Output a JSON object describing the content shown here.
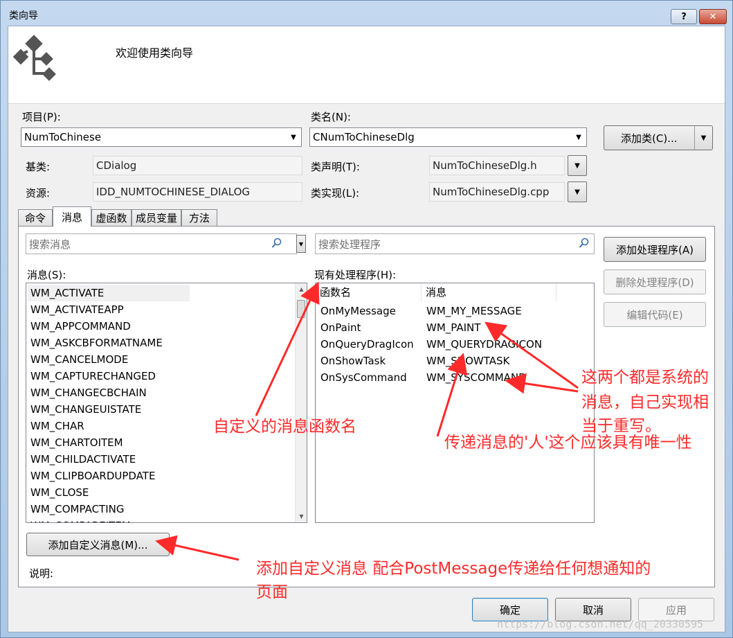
{
  "window": {
    "title": "类向导",
    "help_label": "?",
    "close_label": "✕"
  },
  "banner": {
    "title": "欢迎使用类向导",
    "icon": "class-wizard-icon"
  },
  "project": {
    "label": "项目(P):",
    "value": "NumToChinese"
  },
  "classname": {
    "label": "类名(N):",
    "value": "CNumToChineseDlg"
  },
  "add_class_button": "添加类(C)...",
  "base_class": {
    "label": "基类:",
    "value": "CDialog"
  },
  "class_decl": {
    "label": "类声明(T):",
    "value": "NumToChineseDlg.h"
  },
  "resource": {
    "label": "资源:",
    "value": "IDD_NUMTOCHINESE_DIALOG"
  },
  "class_impl": {
    "label": "类实现(L):",
    "value": "NumToChineseDlg.cpp"
  },
  "tabs": [
    "命令",
    "消息",
    "虚函数",
    "成员变量",
    "方法"
  ],
  "active_tab": "消息",
  "search_messages": {
    "placeholder": "搜索消息"
  },
  "search_handlers": {
    "placeholder": "搜索处理程序"
  },
  "messages": {
    "label": "消息(S):",
    "items": [
      "WM_ACTIVATE",
      "WM_ACTIVATEAPP",
      "WM_APPCOMMAND",
      "WM_ASKCBFORMATNAME",
      "WM_CANCELMODE",
      "WM_CAPTURECHANGED",
      "WM_CHANGECBCHAIN",
      "WM_CHANGEUISTATE",
      "WM_CHAR",
      "WM_CHARTOITEM",
      "WM_CHILDACTIVATE",
      "WM_CLIPBOARDUPDATE",
      "WM_CLOSE",
      "WM_COMPACTING",
      "WM_COMPAREITEM"
    ],
    "selected": "WM_ACTIVATE"
  },
  "handlers": {
    "label": "现有处理程序(H):",
    "columns": [
      "函数名",
      "消息"
    ],
    "rows": [
      [
        "OnMyMessage",
        "WM_MY_MESSAGE"
      ],
      [
        "OnPaint",
        "WM_PAINT"
      ],
      [
        "OnQueryDragIcon",
        "WM_QUERYDRAGICON"
      ],
      [
        "OnShowTask",
        "WM_SHOWTASK"
      ],
      [
        "OnSysCommand",
        "WM_SYSCOMMAND"
      ]
    ]
  },
  "buttons": {
    "add_handler": "添加处理程序(A)",
    "delete_handler": "删除处理程序(D)",
    "edit_code": "编辑代码(E)",
    "add_custom_message": "添加自定义消息(M)...",
    "ok": "确定",
    "cancel": "取消",
    "apply": "应用"
  },
  "description_label": "说明:",
  "annotations": {
    "custom_func_name": "自定义的消息函数名",
    "system_msgs_line1": "这两个都是系统的",
    "system_msgs_line2": "消息，自己实现相",
    "system_msgs_line3": "当于重写。",
    "unique": "传递消息的'人'这个应该具有唯一性",
    "add_custom_line1": "添加自定义消息 配合PostMessage传递给任何想通知的",
    "add_custom_line2": "页面"
  },
  "annotation_color": "#ff2a2a",
  "watermark": "https://blog.csdn.net/qq_20330595"
}
